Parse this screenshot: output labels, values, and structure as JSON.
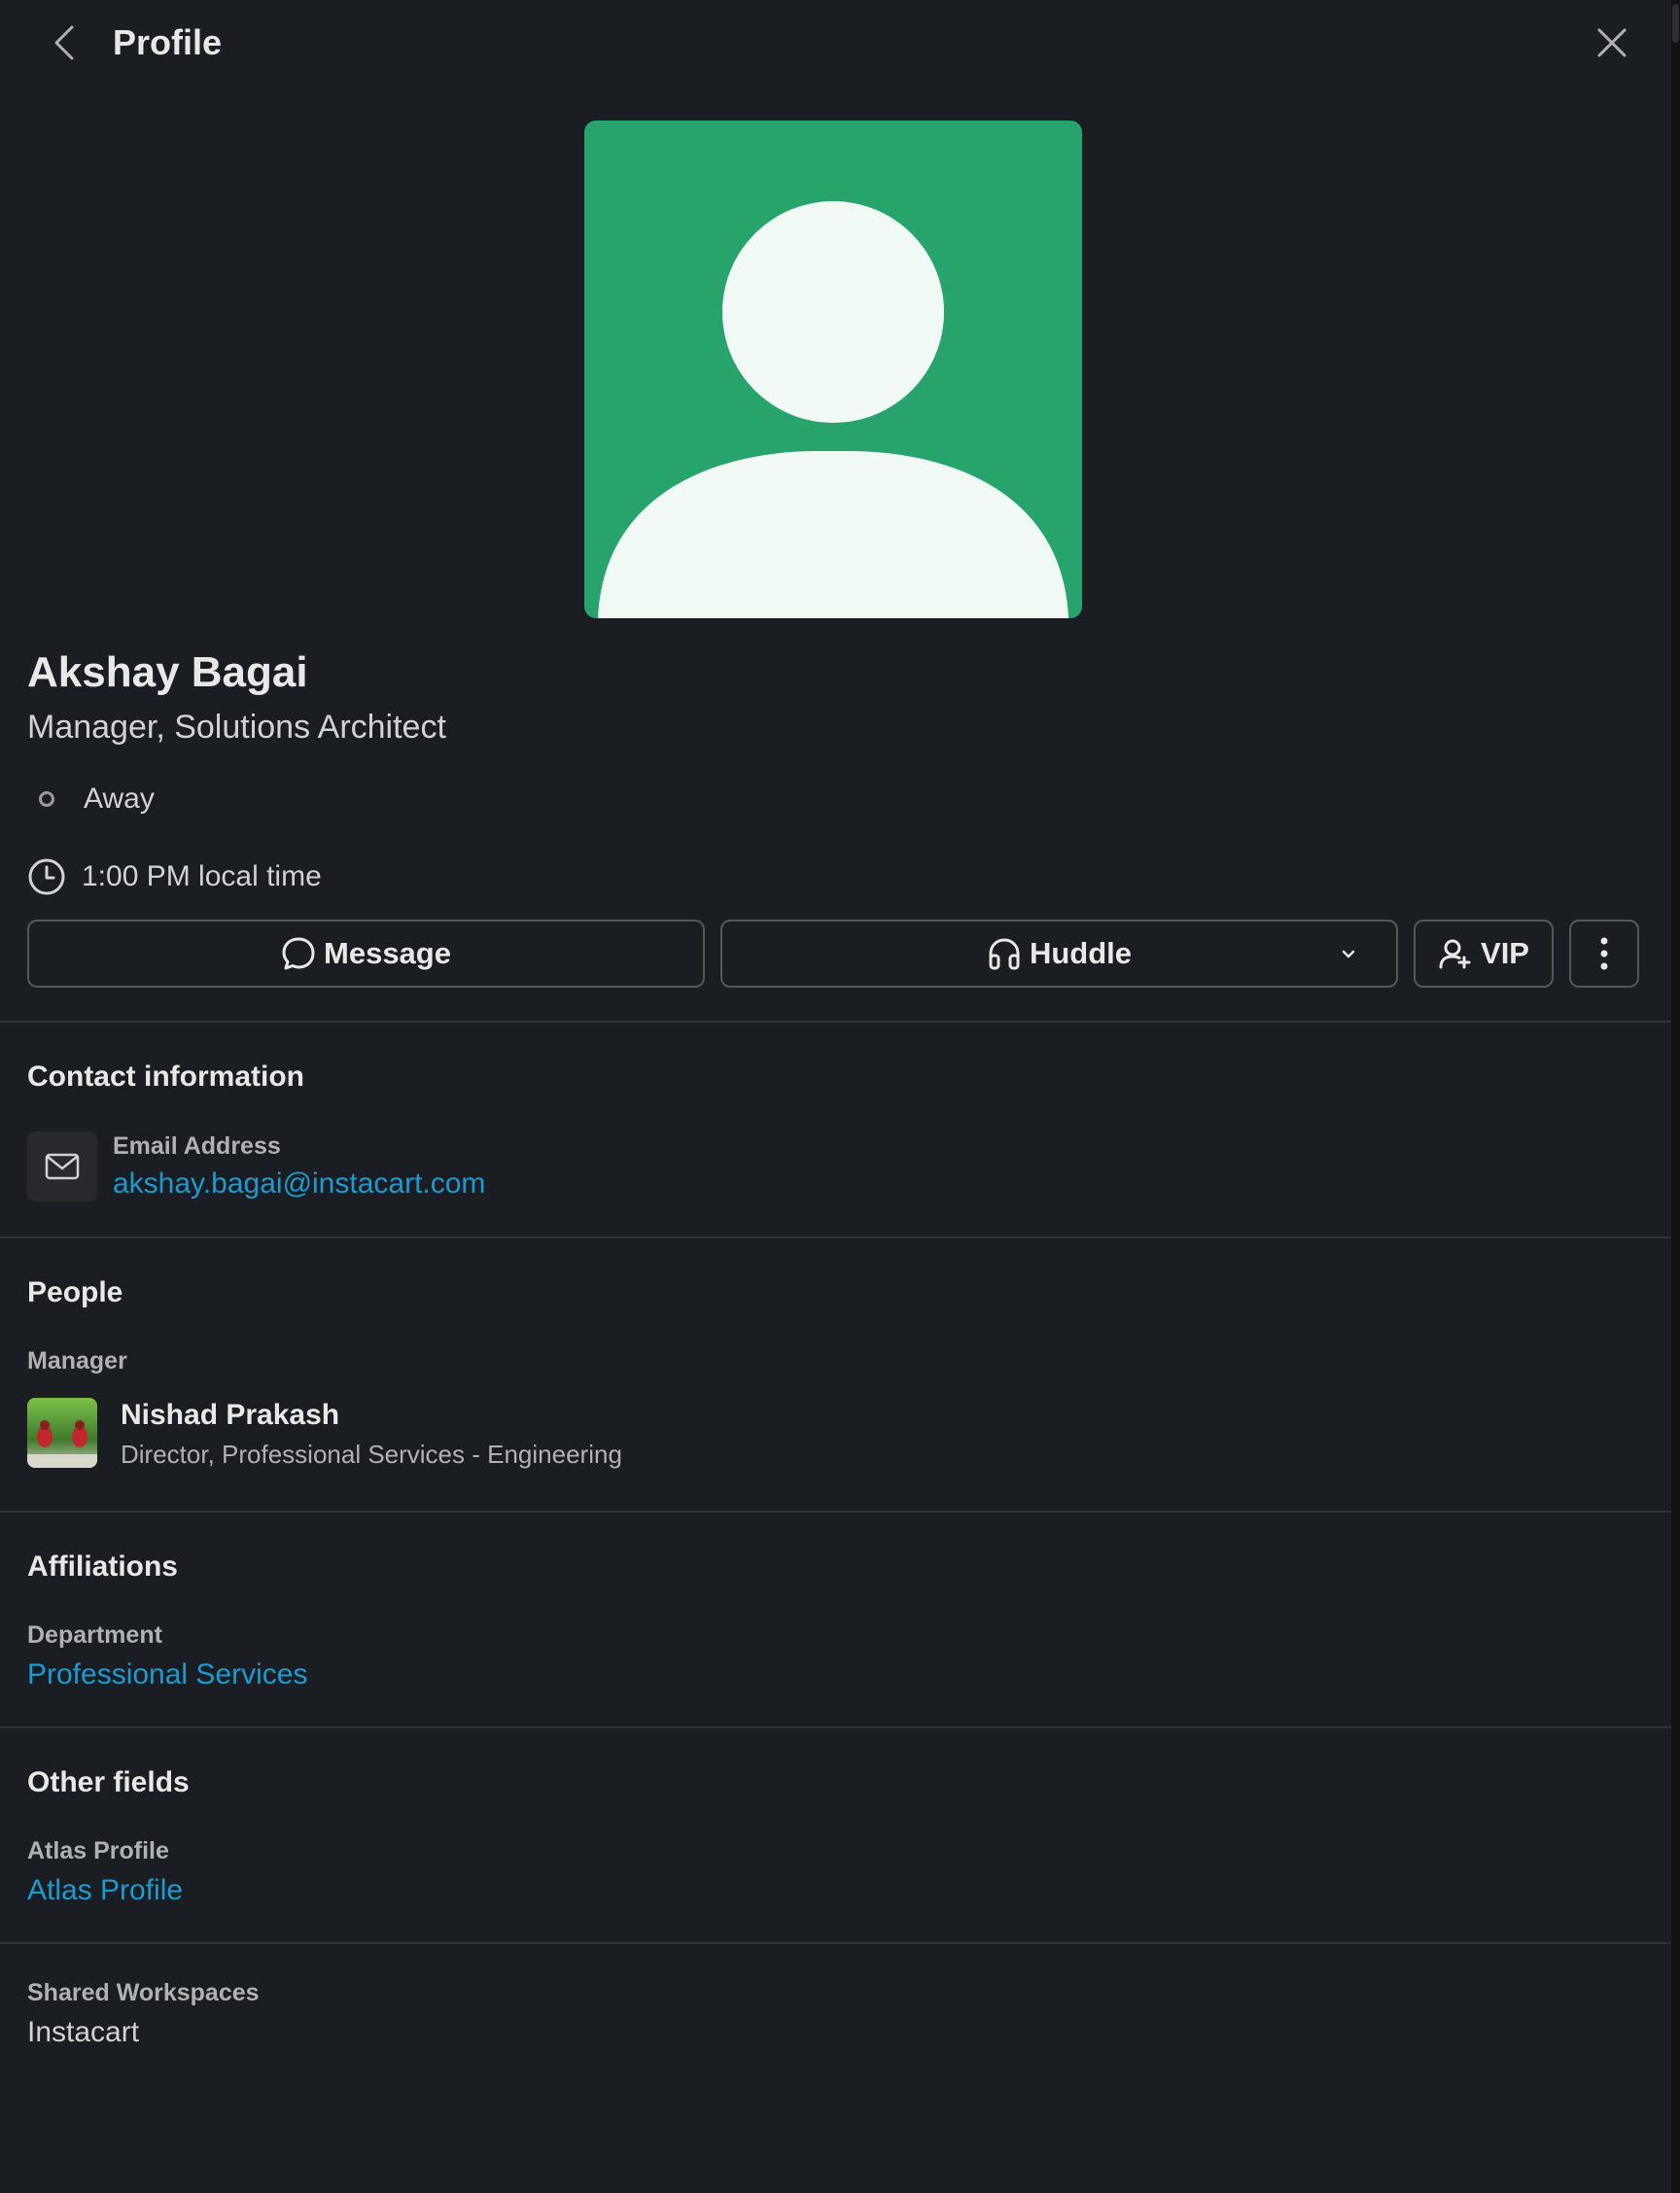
{
  "header": {
    "title": "Profile"
  },
  "profile": {
    "name": "Akshay Bagai",
    "title": "Manager, Solutions Architect",
    "status": "Away",
    "local_time": "1:00 PM local time",
    "avatar_color": "#27a46c"
  },
  "actions": {
    "message_label": "Message",
    "huddle_label": "Huddle",
    "vip_label": "VIP"
  },
  "contact": {
    "section_title": "Contact information",
    "email_label": "Email Address",
    "email": "akshay.bagai@instacart.com"
  },
  "people": {
    "section_title": "People",
    "manager_label": "Manager",
    "manager_name": "Nishad Prakash",
    "manager_title": "Director, Professional Services - Engineering"
  },
  "affiliations": {
    "section_title": "Affiliations",
    "department_label": "Department",
    "department": "Professional Services"
  },
  "other_fields": {
    "section_title": "Other fields",
    "atlas_label": "Atlas Profile",
    "atlas_link": "Atlas Profile"
  },
  "shared": {
    "label": "Shared Workspaces",
    "value": "Instacart"
  },
  "colors": {
    "background": "#1a1d21",
    "link": "#1d9bd1",
    "text": "#d1d2d3",
    "divider": "#2f3236"
  },
  "icons": [
    "back-chevron-icon",
    "close-icon",
    "clock-icon",
    "message-bubble-icon",
    "headphones-icon",
    "chevron-down-icon",
    "add-person-icon",
    "more-vertical-icon",
    "envelope-icon"
  ]
}
